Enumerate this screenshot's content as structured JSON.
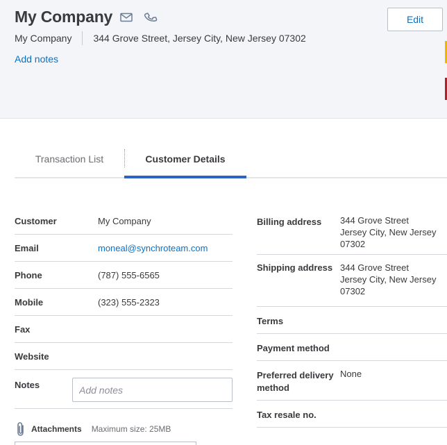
{
  "header": {
    "title": "My Company",
    "company": "My Company",
    "address": "344 Grove Street, Jersey City, New Jersey 07302",
    "add_notes": "Add notes",
    "edit_label": "Edit",
    "icons": [
      "mail-icon",
      "phone-icon"
    ]
  },
  "tabs": [
    {
      "label": "Transaction List",
      "active": false
    },
    {
      "label": "Customer Details",
      "active": true
    }
  ],
  "details": {
    "customer": {
      "label": "Customer",
      "value": "My Company"
    },
    "email": {
      "label": "Email",
      "value": "moneal@synchroteam.com"
    },
    "phone": {
      "label": "Phone",
      "value": "(787) 555-6565"
    },
    "mobile": {
      "label": "Mobile",
      "value": "(323) 555-2323"
    },
    "fax": {
      "label": "Fax",
      "value": ""
    },
    "website": {
      "label": "Website",
      "value": ""
    },
    "notes": {
      "label": "Notes",
      "placeholder": "Add notes",
      "value": ""
    }
  },
  "attachments": {
    "label": "Attachments",
    "max_size": "Maximum size: 25MB"
  },
  "right": {
    "billing": {
      "label": "Billing address",
      "lines": [
        "344 Grove Street",
        "Jersey City, New Jersey",
        "07302"
      ]
    },
    "shipping": {
      "label": "Shipping address",
      "lines": [
        "344 Grove Street",
        "Jersey City, New Jersey",
        "07302"
      ]
    },
    "terms": {
      "label": "Terms",
      "value": ""
    },
    "payment": {
      "label": "Payment method",
      "value": ""
    },
    "delivery": {
      "label": "Preferred delivery method",
      "value": "None"
    },
    "tax": {
      "label": "Tax resale no.",
      "value": ""
    }
  },
  "colors": {
    "link": "#0a70c5",
    "tab_accent": "#2d63c8",
    "header_bg": "#f4f5f8",
    "accent_yellow": "#f2b600",
    "accent_red": "#b0232a"
  }
}
